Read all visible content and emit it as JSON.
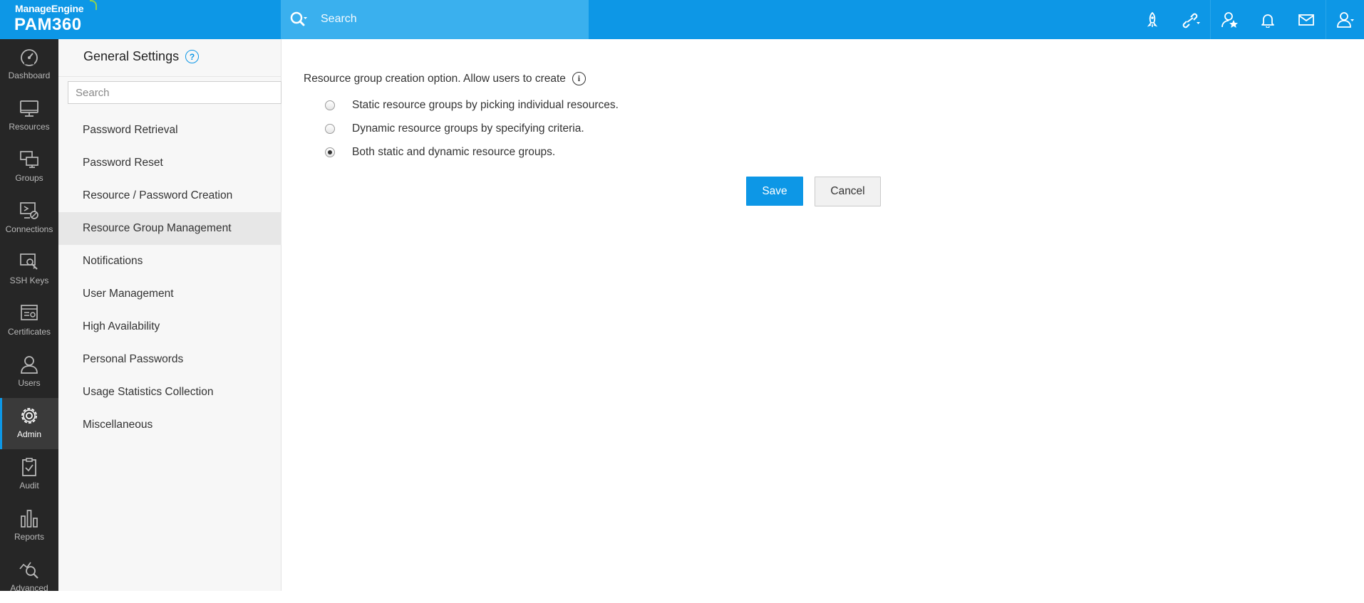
{
  "header": {
    "brand": "ManageEngine",
    "product": "PAM360",
    "search_placeholder": "Search",
    "icons": [
      "rocket-icon",
      "link-icon",
      "star-user-icon",
      "bell-icon",
      "mail-icon",
      "user-icon"
    ]
  },
  "nav": {
    "items": [
      {
        "label": "Dashboard",
        "icon": "dashboard-icon"
      },
      {
        "label": "Resources",
        "icon": "monitor-icon"
      },
      {
        "label": "Groups",
        "icon": "groups-icon"
      },
      {
        "label": "Connections",
        "icon": "connections-icon"
      },
      {
        "label": "SSH Keys",
        "icon": "ssh-keys-icon"
      },
      {
        "label": "Certificates",
        "icon": "certificates-icon"
      },
      {
        "label": "Users",
        "icon": "users-icon"
      },
      {
        "label": "Admin",
        "icon": "gear-icon",
        "active": true
      },
      {
        "label": "Audit",
        "icon": "clipboard-icon"
      },
      {
        "label": "Reports",
        "icon": "reports-icon"
      },
      {
        "label": "Advanced",
        "icon": "advanced-icon"
      }
    ]
  },
  "settings": {
    "title": "General Settings",
    "help": "?",
    "search_placeholder": "Search",
    "menu": [
      "Password Retrieval",
      "Password Reset",
      "Resource / Password Creation",
      "Resource Group Management",
      "Notifications",
      "User Management",
      "High Availability",
      "Personal Passwords",
      "Usage Statistics Collection",
      "Miscellaneous"
    ],
    "active_item": "Resource Group Management"
  },
  "main": {
    "option_label": "Resource group creation option. Allow users to create",
    "info": "i",
    "options": [
      {
        "label": "Static resource groups by picking individual resources.",
        "checked": false
      },
      {
        "label": "Dynamic resource groups by specifying criteria.",
        "checked": false
      },
      {
        "label": "Both static and dynamic resource groups.",
        "checked": true
      }
    ],
    "save_label": "Save",
    "cancel_label": "Cancel"
  },
  "colors": {
    "accent": "#0d97e6",
    "topbar": "#0d97e6",
    "search_bg": "#3ab0ee",
    "nav_bg": "#262626"
  }
}
